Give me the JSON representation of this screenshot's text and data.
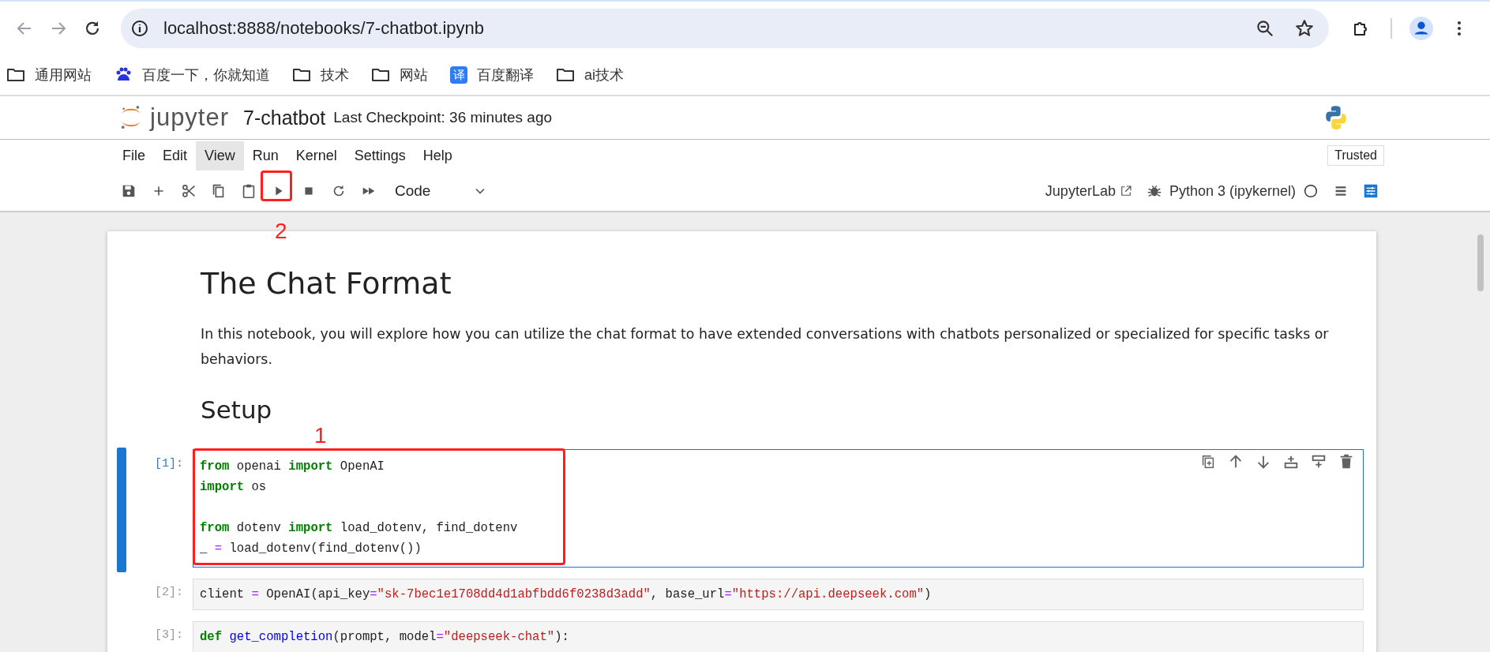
{
  "browser": {
    "url": "localhost:8888/notebooks/7-chatbot.ipynb"
  },
  "bookmarks": [
    {
      "kind": "folder",
      "label": "通用网站"
    },
    {
      "kind": "paw",
      "label": "百度一下，你就知道"
    },
    {
      "kind": "folder",
      "label": "技术"
    },
    {
      "kind": "folder",
      "label": "网站"
    },
    {
      "kind": "translate",
      "label": "百度翻译",
      "icon_text": "译"
    },
    {
      "kind": "folder",
      "label": "ai技术"
    }
  ],
  "header": {
    "logo_text": "jupyter",
    "notebook_name": "7-chatbot",
    "checkpoint": "Last Checkpoint: 36 minutes ago"
  },
  "menu": [
    {
      "label": "File",
      "selected": false
    },
    {
      "label": "Edit",
      "selected": false
    },
    {
      "label": "View",
      "selected": true
    },
    {
      "label": "Run",
      "selected": false
    },
    {
      "label": "Kernel",
      "selected": false
    },
    {
      "label": "Settings",
      "selected": false
    },
    {
      "label": "Help",
      "selected": false
    }
  ],
  "trusted": "Trusted",
  "toolbar": {
    "tools": [
      {
        "kind": "save"
      },
      {
        "kind": "add"
      },
      {
        "kind": "cut"
      },
      {
        "kind": "copy"
      },
      {
        "kind": "paste"
      },
      {
        "kind": "run"
      },
      {
        "kind": "stop"
      },
      {
        "kind": "restart"
      },
      {
        "kind": "fastforward"
      }
    ],
    "cell_type": "Code",
    "jupyterlab": "JupyterLab",
    "kernel": "Python 3 (ipykernel)"
  },
  "notebook": {
    "title": "The Chat Format",
    "intro": "In this notebook, you will explore how you can utilize the chat format to have extended conversations with chatbots personalized or specialized for specific tasks or behaviors.",
    "subtitle": "Setup",
    "cells": [
      {
        "prompt": "[1]:",
        "selected": true,
        "blocks": [
          {
            "lines": [
              {
                "tokens": [
                  {
                    "text": "from",
                    "kind": "keyword"
                  },
                  {
                    "text": " openai ",
                    "kind": "plain"
                  },
                  {
                    "text": "import",
                    "kind": "keyword"
                  },
                  {
                    "text": " OpenAI",
                    "kind": "plain"
                  }
                ]
              },
              {
                "tokens": [
                  {
                    "text": "import",
                    "kind": "keyword"
                  },
                  {
                    "text": " os",
                    "kind": "plain"
                  }
                ]
              }
            ]
          },
          {
            "lines": [
              {
                "tokens": [
                  {
                    "text": "from",
                    "kind": "keyword"
                  },
                  {
                    "text": " dotenv ",
                    "kind": "plain"
                  },
                  {
                    "text": "import",
                    "kind": "keyword"
                  },
                  {
                    "text": " load_dotenv, find_dotenv",
                    "kind": "plain"
                  }
                ]
              },
              {
                "tokens": [
                  {
                    "text": "_ ",
                    "kind": "plain"
                  },
                  {
                    "text": "=",
                    "kind": "operator"
                  },
                  {
                    "text": " load_dotenv(find_dotenv())",
                    "kind": "plain"
                  }
                ]
              }
            ]
          }
        ]
      },
      {
        "prompt": "[2]:",
        "selected": false,
        "blocks": [
          {
            "lines": [
              {
                "tokens": [
                  {
                    "text": "client ",
                    "kind": "plain"
                  },
                  {
                    "text": "=",
                    "kind": "operator"
                  },
                  {
                    "text": " OpenAI(api_key",
                    "kind": "plain"
                  },
                  {
                    "text": "=",
                    "kind": "operator"
                  },
                  {
                    "text": "\"sk-7bec1e1708dd4d1abfbdd6f0238d3add\"",
                    "kind": "string"
                  },
                  {
                    "text": ", base_url",
                    "kind": "plain"
                  },
                  {
                    "text": "=",
                    "kind": "operator"
                  },
                  {
                    "text": "\"https://api.deepseek.com\"",
                    "kind": "string"
                  },
                  {
                    "text": ")",
                    "kind": "plain"
                  }
                ]
              }
            ]
          }
        ]
      },
      {
        "prompt": "[3]:",
        "selected": false,
        "blocks": [
          {
            "lines": [
              {
                "tokens": [
                  {
                    "text": "def",
                    "kind": "keyword"
                  },
                  {
                    "text": " get_completion",
                    "kind": "function"
                  },
                  {
                    "text": "(prompt, model",
                    "kind": "plain"
                  },
                  {
                    "text": "=",
                    "kind": "operator"
                  },
                  {
                    "text": "\"deepseek-chat\"",
                    "kind": "string"
                  },
                  {
                    "text": "):",
                    "kind": "plain"
                  }
                ]
              }
            ]
          }
        ]
      }
    ]
  },
  "annotations": [
    {
      "label": "2",
      "kind": "run"
    },
    {
      "label": "1",
      "kind": "cell"
    }
  ]
}
